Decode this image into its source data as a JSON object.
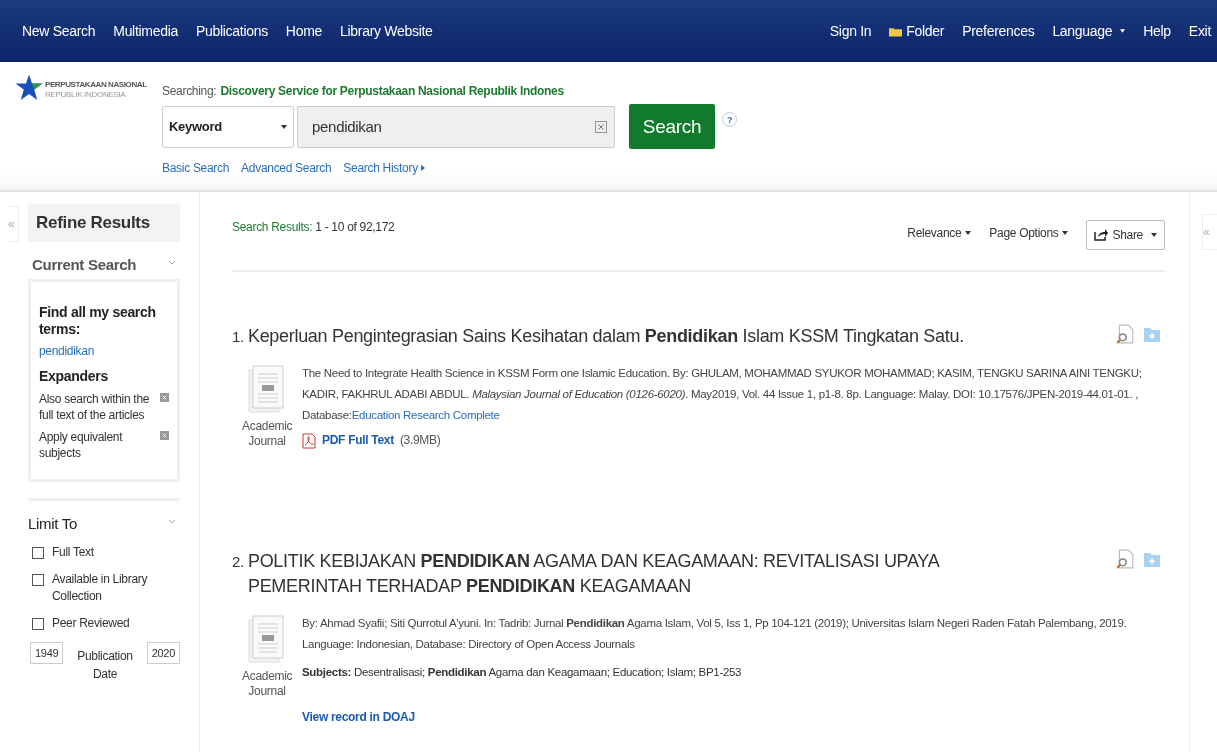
{
  "nav": {
    "left": [
      {
        "label": "New Search"
      },
      {
        "label": "Multimedia"
      },
      {
        "label": "Publications"
      },
      {
        "label": "Home"
      },
      {
        "label": "Library Website"
      }
    ],
    "right": [
      {
        "label": "Sign In",
        "kind": "plain"
      },
      {
        "label": "Folder",
        "kind": "folder"
      },
      {
        "label": "Preferences",
        "kind": "plain"
      },
      {
        "label": "Language",
        "kind": "menu"
      },
      {
        "label": "Help",
        "kind": "plain"
      },
      {
        "label": "Exit",
        "kind": "plain"
      }
    ]
  },
  "header": {
    "logo": {
      "name": "PERPUSTAKAAN NASIONAL",
      "sub": "REPUBLIK INDONESIA"
    },
    "searching_label": "Searching:",
    "searching_value": "Discovery Service for Perpustakaan Nasional Republik Indones",
    "field_select": "Keyword",
    "query": "pendidikan",
    "search_button": "Search",
    "help": "?",
    "links": [
      {
        "label": "Basic Search",
        "kind": "plain"
      },
      {
        "label": "Advanced Search",
        "kind": "plain"
      },
      {
        "label": "Search History",
        "kind": "menu"
      }
    ]
  },
  "sidebar": {
    "collapse": "«",
    "title": "Refine Results",
    "current_search": {
      "heading": "Current Search",
      "terms_label": "Find all my search terms:",
      "term": "pendidikan",
      "expanders_label": "Expanders",
      "expanders": [
        {
          "label": "Also search within the full text of the articles"
        },
        {
          "label": "Apply equivalent subjects"
        }
      ]
    },
    "limit_to": {
      "heading": "Limit To",
      "options": [
        {
          "label": "Full Text",
          "checked": false
        },
        {
          "label": "Available in Library Collection",
          "checked": false
        },
        {
          "label": "Peer Reviewed",
          "checked": false
        }
      ],
      "date_from": "1949",
      "date_label": "Publication Date",
      "date_to": "2020"
    }
  },
  "right_panel": {
    "collapse": "«"
  },
  "results": {
    "summary_label": "Search Results:",
    "summary_value": "1 - 10 of 92,172",
    "sort": "Relevance",
    "page_options": "Page Options",
    "share": "Share",
    "items": [
      {
        "number": "1.",
        "title": "Keperluan Pengintegrasian Sains Kesihatan dalam **Pendidikan** Islam KSSM Tingkatan Satu.",
        "type": "Academic Journal",
        "details": "The Need to Integrate Health Science in KSSM Form one Islamic Education. By: GHULAM, MOHAMMAD SYUKOR MOHAMMAD; KASIM, TENGKU SARINA AINI TENGKU; KADIR, FAKHRUL ADABI ABDUL. *Malaysian Journal of Education (0126-6020)*. May2019, Vol. 44 Issue 1, p1-8. 8p. Language: Malay. DOI: 10.17576/JPEN-2019-44.01-01. , Database:",
        "database_link": "Education Research Complete",
        "links": [
          {
            "label": "PDF Full Text",
            "size": "(3.9MB)",
            "kind": "pdf"
          }
        ]
      },
      {
        "number": "2.",
        "title": "POLITIK KEBIJAKAN **PENDIDIKAN** AGAMA DAN KEAGAMAAN: REVITALISASI UPAYA PEMERINTAH TERHADAP **PENDIDIKAN** KEAGAMAAN",
        "type": "Academic Journal",
        "details": "By: Ahmad Syafii; Siti Qurrotul A'yuni. In: Tadrib: Jurnal **Pendidikan** Agama Islam, Vol 5, Iss 1, Pp 104-121 (2019); Universitas Islam Negeri Raden Fatah Palembang, 2019. Language: Indonesian, Database: Directory of Open Access Journals",
        "subjects_label": "Subjects:",
        "subjects": "Desentralisasi; **Pendidikan** Agama dan Keagamaan; Education; Islam; BP1-253",
        "links": [
          {
            "label": "View record in DOAJ",
            "kind": "link"
          }
        ]
      }
    ]
  }
}
